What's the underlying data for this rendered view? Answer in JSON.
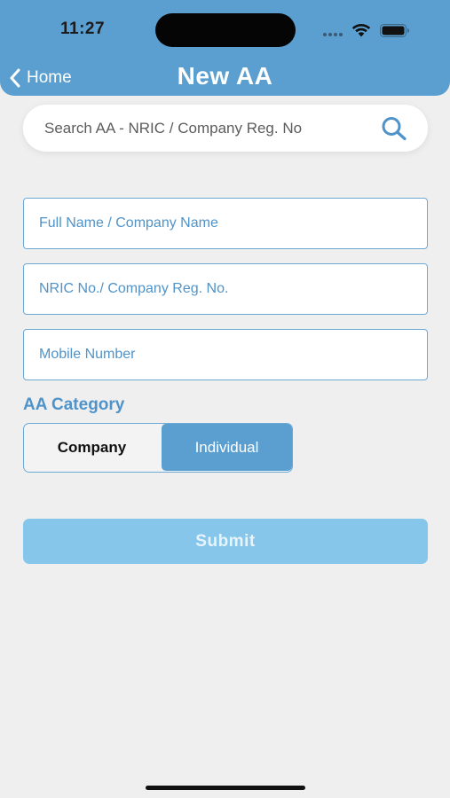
{
  "status_bar": {
    "time": "11:27"
  },
  "header": {
    "back_label": "Home",
    "title": "New AA",
    "background_color": "#5a9fd0"
  },
  "search": {
    "placeholder": "Search AA - NRIC / Company Reg. No",
    "icon": "search-icon"
  },
  "form": {
    "full_name_placeholder": "Full Name / Company Name",
    "nric_placeholder": "NRIC No./ Company Reg. No.",
    "mobile_placeholder": "Mobile Number",
    "category_label": "AA Category",
    "category_options": [
      "Company",
      "Individual"
    ],
    "selected_category": "Individual",
    "submit_label": "Submit"
  },
  "colors": {
    "accent": "#5a9fd0",
    "submit_disabled": "#86c6ea",
    "label_blue": "#4f93c9"
  }
}
